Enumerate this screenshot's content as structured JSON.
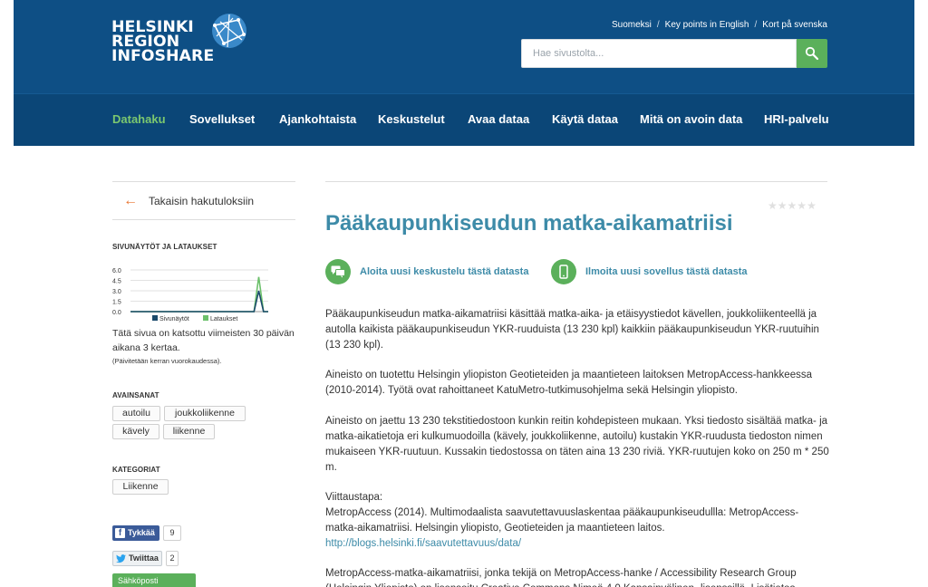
{
  "logo": {
    "line1": "HELSINKI",
    "line2": "REGION",
    "line3": "INFOSHARE"
  },
  "header": {
    "lang_links": [
      "Suomeksi",
      "Key points in English",
      "Kort på svenska"
    ],
    "search_placeholder": "Hae sivustolta..."
  },
  "nav": {
    "items": [
      "Datahaku",
      "Sovellukset",
      "Ajankohtaista",
      "Keskustelut",
      "Avaa dataa",
      "Käytä dataa",
      "Mitä on avoin data",
      "HRI-palvelu"
    ],
    "active": "Datahaku"
  },
  "sidebar": {
    "back_label": "Takaisin hakutuloksiin",
    "stats_heading": "SIVUNÄYTÖT JA LATAUKSET",
    "views_text": "Tätä sivua on katsottu viimeisten 30 päivän aikana 3 kertaa.",
    "views_note": "(Päivitetään kerran vuorokaudessa).",
    "keywords_heading": "AVAINSANAT",
    "keywords": [
      "autoilu",
      "joukkoliikenne",
      "kävely",
      "liikenne"
    ],
    "categories_heading": "KATEGORIAT",
    "categories": [
      "Liikenne"
    ],
    "social": {
      "fb_label": "Tykkää",
      "fb_count": "9",
      "tw_label": "Twiittaa",
      "tw_count": "2",
      "mail_label": "Sähköposti"
    }
  },
  "chart_data": {
    "type": "line",
    "y_ticks": [
      "6.0",
      "4.5",
      "3.0",
      "1.5",
      "0.0"
    ],
    "ylim": [
      0,
      6
    ],
    "series": [
      {
        "name": "Sivunäytöt",
        "color": "#1b4a6b",
        "values": [
          0,
          0,
          0,
          0,
          0,
          0,
          0,
          0,
          0,
          0,
          0,
          0,
          0,
          0,
          0,
          0,
          0,
          0,
          0,
          0,
          0,
          0,
          0,
          0,
          0,
          0,
          0,
          3,
          0,
          0
        ]
      },
      {
        "name": "Lataukset",
        "color": "#6cc06b",
        "values": [
          0,
          0,
          0,
          0,
          0,
          0,
          0,
          0,
          0,
          0,
          0,
          0,
          0,
          0,
          0,
          0,
          0,
          0,
          0,
          0,
          0,
          0,
          0,
          0,
          0,
          0,
          0,
          5,
          0,
          0
        ]
      }
    ]
  },
  "main": {
    "title": "Pääkaupunkiseudun matka-aikamatriisi",
    "action_discuss": "Aloita uusi keskustelu tästä datasta",
    "action_app": "Ilmoita uusi sovellus tästä datasta",
    "p1": "Pääkaupunkiseudun matka-aikamatriisi käsittää matka-aika- ja etäisyystiedot kävellen, joukkoliikenteellä ja autolla kaikista pääkaupunkiseudun YKR-ruuduista (13 230 kpl) kaikkiin pääkaupunkiseudun YKR-ruutuihin (13 230 kpl).",
    "p2": "Aineisto on tuotettu Helsingin yliopiston Geotieteiden ja maantieteen laitoksen MetropAccess-hankkeessa (2010-2014). Työtä ovat rahoittaneet KatuMetro-tutkimusohjelma sekä Helsingin yliopisto.",
    "p3": "Aineisto on jaettu 13 230 tekstitiedostoon kunkin reitin kohdepisteen mukaan. Yksi tiedosto sisältää matka- ja matka-aikatietoja eri kulkumuodoilla (kävely, joukkoliikenne, autoilu) kustakin YKR-ruudusta tiedoston nimen mukaiseen YKR-ruutuun. Kussakin tiedostossa on täten aina 13 230 riviä. YKR-ruutujen koko on 250 m * 250 m.",
    "p4_heading": "Viittaustapa:",
    "p4_text": "MetropAccess (2014). Multimodaalista saavutettavuuslaskentaa pääkaupunkiseudullla: MetropAccess-matka-aikamatriisi. Helsingin yliopisto, Geotieteiden ja maantieteen laitos.",
    "p4_link": "http://blogs.helsinki.fi/saavutettavuus/data/",
    "p5": "MetropAccess-matka-aikamatriisi, jonka tekijä on MetropAccess-hanke / Accessibility Research Group (Helsingin Yliopisto) on lisensoitu Creative Commons Nimeä 4.0 Kansainvälinen -lisenssillä. Lisätietoa"
  }
}
